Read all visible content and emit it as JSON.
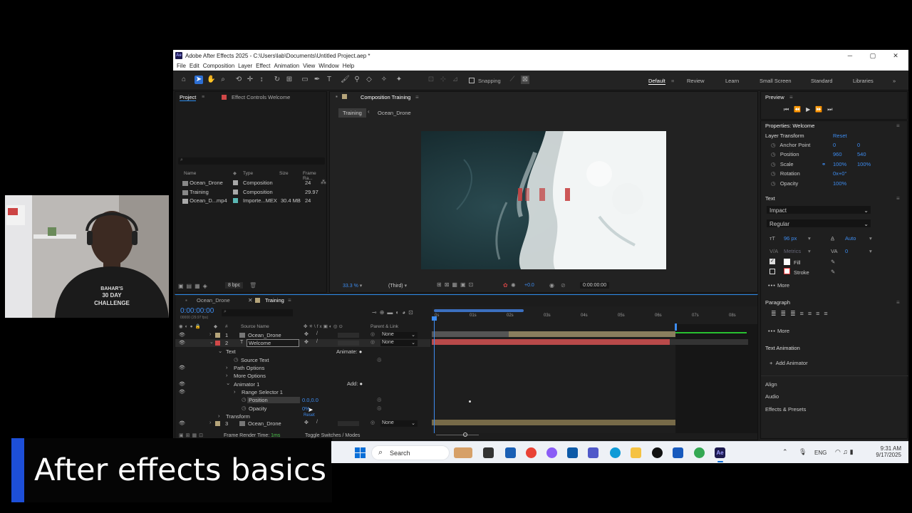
{
  "window": {
    "title": "Adobe After Effects 2025 - C:\\Users\\lab\\Documents\\Untitled Project.aep *",
    "logo": "Ae"
  },
  "menu": [
    "File",
    "Edit",
    "Composition",
    "Layer",
    "Effect",
    "Animation",
    "View",
    "Window",
    "Help"
  ],
  "toolbar": {
    "snapping": "Snapping"
  },
  "workspaces": [
    "Default",
    "Review",
    "Learn",
    "Small Screen",
    "Standard",
    "Libraries"
  ],
  "project": {
    "tab": "Project",
    "tab2": "Effect Controls Welcome",
    "columns": [
      "Name",
      "Type",
      "Size",
      "Frame Ra..."
    ],
    "items": [
      {
        "name": "Ocean_Drone",
        "type": "Composition",
        "size": "",
        "rate": "24",
        "color": "#a8a8a8"
      },
      {
        "name": "Training",
        "type": "Composition",
        "size": "",
        "rate": "29.97",
        "color": "#a8a8a8"
      },
      {
        "name": "Ocean_D...mp4",
        "type": "Importe...MEX",
        "size": "30.4 MB",
        "rate": "24",
        "color": "#5ab8b4"
      }
    ],
    "bpc": "8 bpc"
  },
  "composition": {
    "tab": "Composition Training",
    "crumb1": "Training",
    "crumb2": "Ocean_Drone",
    "zoom": "33.3 %",
    "res": "(Third)",
    "exposure": "+0.0",
    "timecode": "0:00:00:00"
  },
  "timeline": {
    "tabs": [
      "Ocean_Drone",
      "Training"
    ],
    "timecode": "0:00:00:00",
    "fps": "00000 (29.97 fps)",
    "col_source": "Source Name",
    "col_parent": "Parent & Link",
    "ruler": [
      "0s",
      "01s",
      "02s",
      "03s",
      "04s",
      "05s",
      "06s",
      "07s",
      "08s"
    ],
    "layers": [
      {
        "num": "1",
        "name": "Ocean_Drone",
        "parent": "None"
      },
      {
        "num": "2",
        "name": "Welcome",
        "parent": "None"
      },
      {
        "num": "3",
        "name": "Ocean_Drone",
        "parent": "None"
      }
    ],
    "props": {
      "text": "Text",
      "animate": "Animate:",
      "source_text": "Source Text",
      "path_options": "Path Options",
      "more_options": "More Options",
      "animator": "Animator 1",
      "add": "Add:",
      "range": "Range Selector 1",
      "position": "Position",
      "position_val": "0.0,0.0",
      "opacity": "Opacity",
      "opacity_val": "0%",
      "transform": "Transform",
      "reset": "Reset"
    },
    "footer_render": "Frame Render Time:",
    "footer_ms": "1ms",
    "footer_toggle": "Toggle Switches / Modes"
  },
  "preview": {
    "title": "Preview"
  },
  "properties": {
    "title": "Properties: Welcome",
    "layer_transform": "Layer Transform",
    "reset": "Reset",
    "rows": [
      {
        "label": "Anchor Point",
        "v1": "0",
        "v2": "0"
      },
      {
        "label": "Position",
        "v1": "960",
        "v2": "540"
      },
      {
        "label": "Scale",
        "v1": "100%",
        "v2": "100%"
      },
      {
        "label": "Rotation",
        "v1": "0x+0°",
        "v2": ""
      },
      {
        "label": "Opacity",
        "v1": "100%",
        "v2": ""
      }
    ],
    "text_section": "Text",
    "font": "Impact",
    "style": "Regular",
    "size": "96 px",
    "leading": "Auto",
    "kerning": "Metrics",
    "tracking": "0",
    "fill": "Fill",
    "stroke": "Stroke",
    "more": "More",
    "paragraph": "Paragraph",
    "more2": "More",
    "text_animation": "Text Animation",
    "add_animator": "Add Animator",
    "align": "Align",
    "audio": "Audio",
    "effects": "Effects & Presets"
  },
  "caption": {
    "text": "After effects basics"
  },
  "taskbar": {
    "search": "Search",
    "lang": "ENG",
    "time": "9:31 AM",
    "date": "9/17/2025"
  },
  "webcam": {
    "shirt1": "BAHAR'S",
    "shirt2": "30 DAY",
    "shirt3": "CHALLENGE"
  },
  "colors": {
    "accent": "#2d8ceb",
    "label_red": "#d04848",
    "label_tan": "#b5a47a"
  }
}
